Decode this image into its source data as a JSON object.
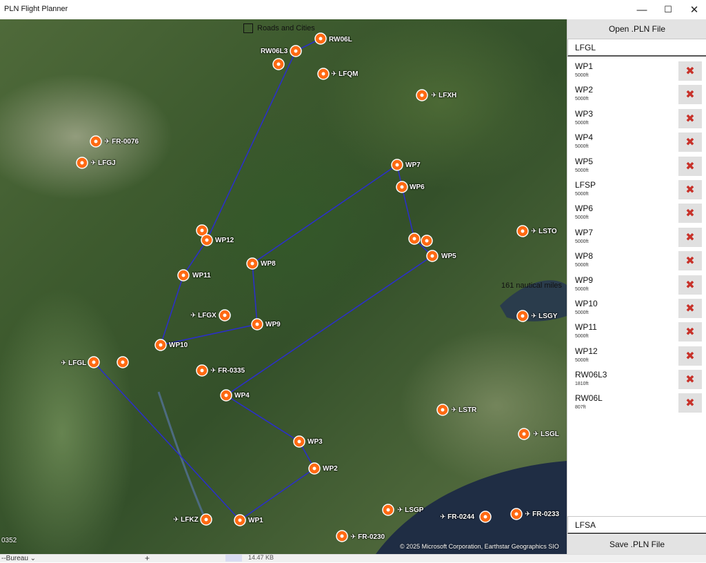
{
  "window": {
    "title": "PLN Flight Planner"
  },
  "icons": {
    "minimize": "minimize-icon",
    "maximize": "maximize-icon",
    "close": "close-icon",
    "delete": "delete-x-icon",
    "airport": "airport-icon",
    "marker": "map-pin-icon"
  },
  "colors": {
    "route": "#2b2fc8",
    "marker": "#ff6a13",
    "delete_x": "#c8322a",
    "button_bg": "#e3e3e3"
  },
  "map": {
    "roads_toggle_label": "Roads and Cities",
    "scale_label": "161 nautical miles",
    "copyright": "© 2025 Microsoft Corporation, Earthstar Geographics SIO",
    "edge_label": "0352",
    "waypoint_labels": [
      {
        "id": "RW06L",
        "text": "RW06L"
      },
      {
        "id": "RW06L3",
        "text": "RW06L3"
      },
      {
        "id": "WP7",
        "text": "WP7"
      },
      {
        "id": "WP6",
        "text": "WP6"
      },
      {
        "id": "WP5",
        "text": "WP5"
      },
      {
        "id": "WP12",
        "text": "WP12"
      },
      {
        "id": "WP8",
        "text": "WP8"
      },
      {
        "id": "WP11",
        "text": "WP11"
      },
      {
        "id": "WP9",
        "text": "WP9"
      },
      {
        "id": "WP10",
        "text": "WP10"
      },
      {
        "id": "WP4",
        "text": "WP4"
      },
      {
        "id": "WP3",
        "text": "WP3"
      },
      {
        "id": "WP2",
        "text": "WP2"
      },
      {
        "id": "WP1",
        "text": "WP1"
      }
    ],
    "airport_labels": [
      {
        "id": "LFQM",
        "text": "LFQM"
      },
      {
        "id": "LFXH",
        "text": "LFXH"
      },
      {
        "id": "FR-0076",
        "text": "FR-0076"
      },
      {
        "id": "LFGJ",
        "text": "LFGJ"
      },
      {
        "id": "LSTO",
        "text": "LSTO"
      },
      {
        "id": "LFGX",
        "text": "LFGX"
      },
      {
        "id": "LSGY",
        "text": "LSGY"
      },
      {
        "id": "LFGL",
        "text": "LFGL"
      },
      {
        "id": "FR-0335",
        "text": "FR-0335"
      },
      {
        "id": "LSTR",
        "text": "LSTR"
      },
      {
        "id": "LSGL",
        "text": "LSGL"
      },
      {
        "id": "LSGP",
        "text": "LSGP"
      },
      {
        "id": "FR-0244",
        "text": "FR-0244"
      },
      {
        "id": "FR-0233",
        "text": "FR-0233"
      },
      {
        "id": "LFKZ",
        "text": "LFKZ"
      },
      {
        "id": "FR-0230",
        "text": "FR-0230"
      }
    ]
  },
  "panel": {
    "open_label": "Open .PLN File",
    "origin": "LFGL",
    "destination": "LFSA",
    "save_label": "Save .PLN File",
    "waypoints": [
      {
        "name": "WP1",
        "alt": "5000ft"
      },
      {
        "name": "WP2",
        "alt": "5000ft"
      },
      {
        "name": "WP3",
        "alt": "5000ft"
      },
      {
        "name": "WP4",
        "alt": "5000ft"
      },
      {
        "name": "WP5",
        "alt": "5000ft"
      },
      {
        "name": "LFSP",
        "alt": "5000ft"
      },
      {
        "name": "WP6",
        "alt": "5000ft"
      },
      {
        "name": "WP7",
        "alt": "5000ft"
      },
      {
        "name": "WP8",
        "alt": "5000ft"
      },
      {
        "name": "WP9",
        "alt": "5000ft"
      },
      {
        "name": "WP10",
        "alt": "5000ft"
      },
      {
        "name": "WP11",
        "alt": "5000ft"
      },
      {
        "name": "WP12",
        "alt": "5000ft"
      },
      {
        "name": "RW06L3",
        "alt": "1810ft"
      },
      {
        "name": "RW06L",
        "alt": "807ft"
      }
    ]
  },
  "taskbar": {
    "folder": "--Bureau ⌄",
    "add": "+",
    "size": "14.47 KB"
  }
}
